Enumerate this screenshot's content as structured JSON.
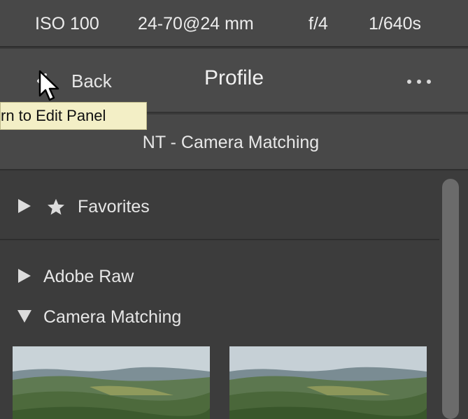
{
  "metadata_bar": {
    "iso": "ISO 100",
    "focal": "24-70@24 mm",
    "aperture": "f/4",
    "shutter": "1/640s"
  },
  "header": {
    "back_label": "Back",
    "title": "Profile",
    "back_icon": "chevron-left-icon",
    "more_icon": "ellipsis-icon"
  },
  "tooltip": {
    "text": "rn to Edit Panel"
  },
  "profile_group": {
    "selected": "NT - Camera Matching"
  },
  "groups": {
    "favorites": {
      "label": "Favorites",
      "icon": "star-icon",
      "expanded": false
    },
    "adobe_raw": {
      "label": "Adobe Raw",
      "expanded": false
    },
    "camera_matching": {
      "label": "Camera Matching",
      "expanded": true
    }
  },
  "colors": {
    "panel_bg": "#3c3c3c",
    "header_bg": "#4a4a4a",
    "tooltip_bg": "#f3efc6",
    "text": "#e6e6e6"
  }
}
